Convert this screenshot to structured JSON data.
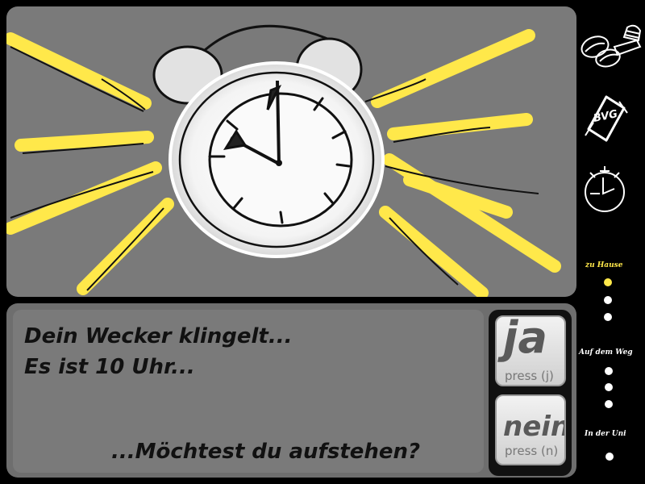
{
  "dialog": {
    "line1": "Dein Wecker klingelt...",
    "line2": "Es ist 10 Uhr...",
    "question": "...Möchtest du aufstehen?"
  },
  "choices": {
    "yes": {
      "label": "ja",
      "hint": "press (j)"
    },
    "no": {
      "label": "nein",
      "hint": "press (n)"
    }
  },
  "inventory": {
    "ticket_text": "BVG",
    "items": [
      "coffee-and-cake-icon",
      "bvg-ticket-icon",
      "stopwatch-icon"
    ]
  },
  "progress": {
    "stages": [
      {
        "label": "zu Hause",
        "steps": 3,
        "active_step": 0,
        "active": true
      },
      {
        "label": "Auf dem Weg",
        "steps": 3,
        "active_step": null,
        "active": false
      },
      {
        "label": "In der Uni",
        "steps": 1,
        "active_step": null,
        "active": false
      }
    ]
  },
  "colors": {
    "background": "#000000",
    "scene": "#7a7a7a",
    "rays": "#ffe84a",
    "active_stage": "#ffe84a",
    "inactive_stage": "#ffffff"
  },
  "scene": {
    "clock_time": "10:00"
  }
}
